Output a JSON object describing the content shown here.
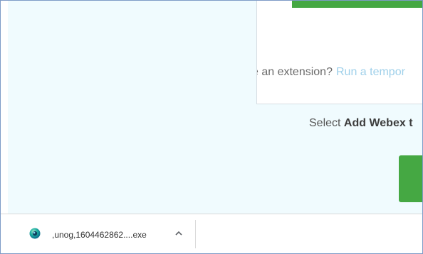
{
  "page": {
    "card": {
      "prompt_text": "e an extension?",
      "link_text": "Run a tempor"
    },
    "instruction": {
      "prefix": "Select",
      "bold_text": "Add Webex t"
    }
  },
  "download_bar": {
    "items": [
      {
        "file_name": ",unog,1604462862....exe",
        "icon": "webex-installer-icon",
        "menu_icon": "chevron-up-icon"
      }
    ]
  },
  "colors": {
    "page_background": "#f0fbfe",
    "accent_green": "#45a843",
    "link_color": "#9fd0ea",
    "window_border": "#7d9bc7"
  }
}
